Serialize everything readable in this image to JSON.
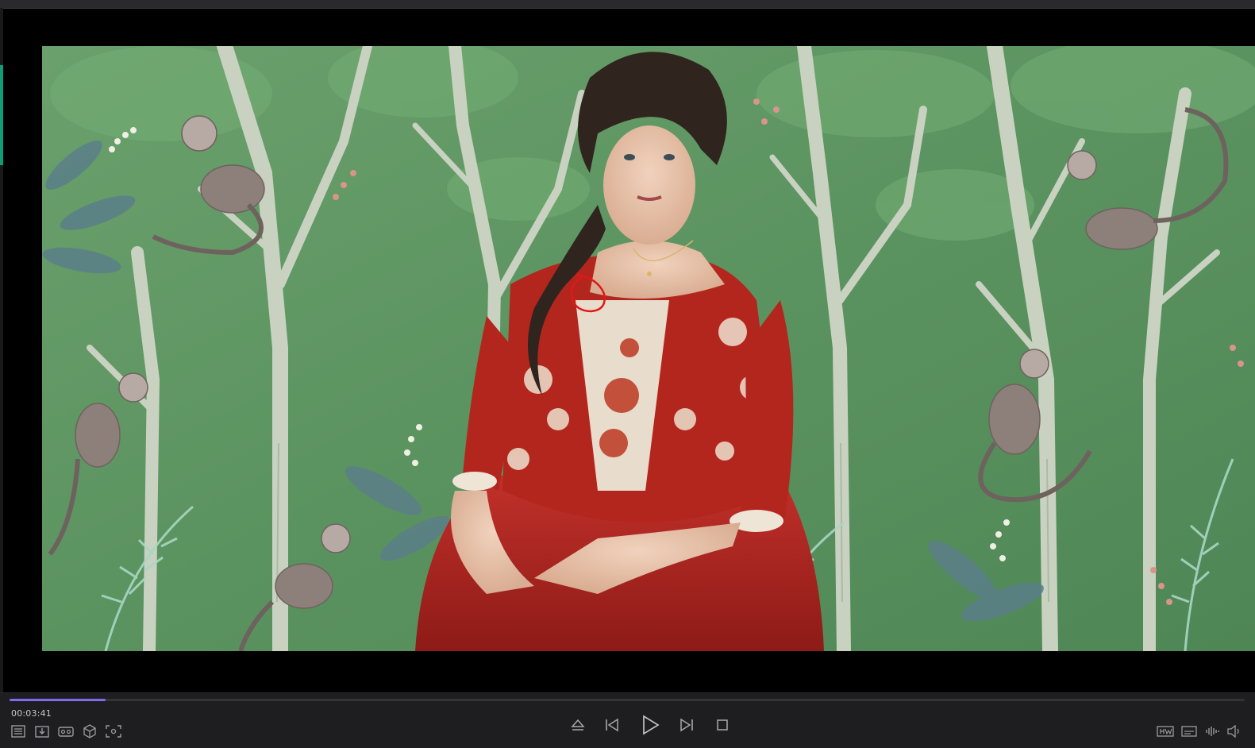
{
  "player": {
    "timecode": "00:03:41",
    "progress_fraction": 0.078
  },
  "colors": {
    "accent": "#7b6cf0",
    "sidebar_accent": "#0f9d77",
    "annotation": "#e01818",
    "wallpaper_green": "#5e9562",
    "dress_red": "#b3261e"
  },
  "left_controls": [
    {
      "icon": "playlist-icon"
    },
    {
      "icon": "download-icon"
    },
    {
      "icon": "vr-view-icon"
    },
    {
      "icon": "3d-cube-icon"
    },
    {
      "icon": "screenshot-icon"
    }
  ],
  "center_controls": [
    {
      "icon": "eject-icon"
    },
    {
      "icon": "skip-previous-icon"
    },
    {
      "icon": "play-icon"
    },
    {
      "icon": "skip-next-icon"
    },
    {
      "icon": "stop-icon"
    }
  ],
  "right_controls": [
    {
      "icon": "hw-acceleration-icon"
    },
    {
      "icon": "subtitles-icon"
    },
    {
      "icon": "audio-waveform-icon"
    },
    {
      "icon": "volume-icon"
    }
  ]
}
